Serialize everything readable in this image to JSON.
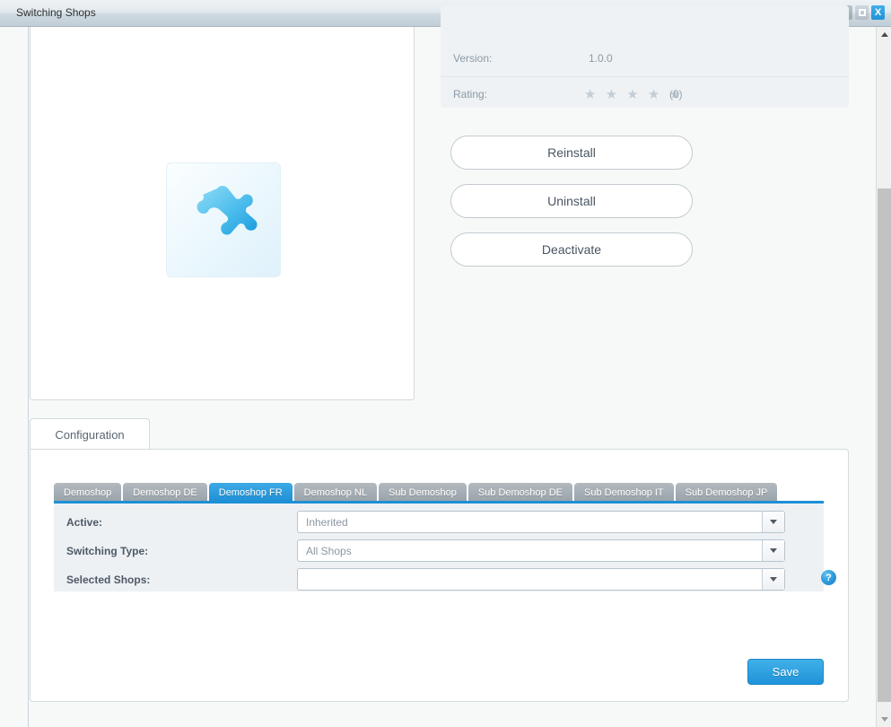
{
  "window": {
    "title": "Switching Shops",
    "controls": {
      "minimize": "minimize-button",
      "maximize": "maximize-button",
      "close_label": "X"
    }
  },
  "plugin": {
    "icon": "puzzle-piece-icon",
    "info_rows": [
      {
        "label": "Version:",
        "value": "1.0.0"
      },
      {
        "label": "Rating:",
        "value": "(0)",
        "stars": "★ ★ ★ ★ ★",
        "star_count": 5,
        "rating_count": 0
      }
    ],
    "actions": [
      {
        "id": "reinstall",
        "label": "Reinstall"
      },
      {
        "id": "uninstall",
        "label": "Uninstall"
      },
      {
        "id": "deactivate",
        "label": "Deactivate"
      }
    ]
  },
  "configuration": {
    "tab_label": "Configuration",
    "shop_tabs": [
      {
        "label": "Demoshop",
        "active": false
      },
      {
        "label": "Demoshop DE",
        "active": false
      },
      {
        "label": "Demoshop FR",
        "active": true
      },
      {
        "label": "Demoshop NL",
        "active": false
      },
      {
        "label": "Sub Demoshop",
        "active": false
      },
      {
        "label": "Sub Demoshop DE",
        "active": false
      },
      {
        "label": "Sub Demoshop IT",
        "active": false
      },
      {
        "label": "Sub Demoshop JP",
        "active": false
      }
    ],
    "fields": [
      {
        "id": "active",
        "label": "Active:",
        "value": "Inherited",
        "has_help": false
      },
      {
        "id": "switching_type",
        "label": "Switching Type:",
        "value": "All Shops",
        "has_help": false
      },
      {
        "id": "selected_shops",
        "label": "Selected Shops:",
        "value": "",
        "has_help": true
      }
    ],
    "help_icon_label": "?",
    "save_label": "Save"
  },
  "colors": {
    "accent": "#1f8fd6",
    "tab_inactive": "#9aa3aa",
    "panel_bg": "#eef1f4",
    "page_bg": "#f7f9f9"
  },
  "scrollbar": {
    "up_icon": "scroll-up-arrow-icon",
    "down_icon": "scroll-down-arrow-icon"
  }
}
